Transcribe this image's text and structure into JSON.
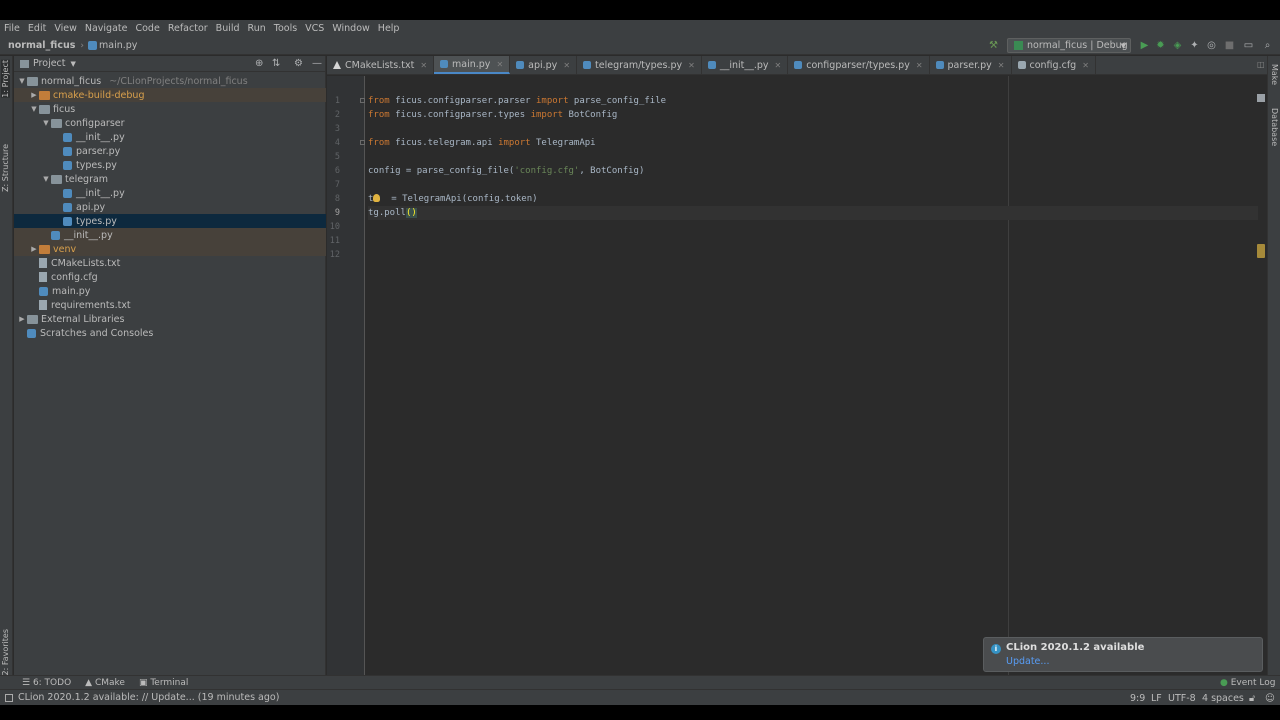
{
  "menu": [
    "File",
    "Edit",
    "View",
    "Navigate",
    "Code",
    "Refactor",
    "Build",
    "Run",
    "Tools",
    "VCS",
    "Window",
    "Help"
  ],
  "breadcrumb": {
    "project": "normal_ficus",
    "file": "main.py"
  },
  "run_config": "normal_ficus | Debug",
  "left_stripe": {
    "project": "1: Project",
    "structure": "Z: Structure",
    "favorites": "2: Favorites"
  },
  "right_stripe": {
    "make": "Make",
    "database": "Database"
  },
  "project_panel": {
    "title": "Project",
    "tree": [
      {
        "label": "normal_ficus",
        "suffix": "~/CLionProjects/normal_ficus",
        "depth": 0,
        "arrow": "▼",
        "icon": "folder"
      },
      {
        "label": "cmake-build-debug",
        "depth": 1,
        "arrow": "▶",
        "icon": "folder-orange",
        "state": "excluded"
      },
      {
        "label": "ficus",
        "depth": 1,
        "arrow": "▼",
        "icon": "folder"
      },
      {
        "label": "configparser",
        "depth": 2,
        "arrow": "▼",
        "icon": "folder"
      },
      {
        "label": "__init__.py",
        "depth": 3,
        "arrow": "",
        "icon": "py"
      },
      {
        "label": "parser.py",
        "depth": 3,
        "arrow": "",
        "icon": "py"
      },
      {
        "label": "types.py",
        "depth": 3,
        "arrow": "",
        "icon": "py"
      },
      {
        "label": "telegram",
        "depth": 2,
        "arrow": "▼",
        "icon": "folder"
      },
      {
        "label": "__init__.py",
        "depth": 3,
        "arrow": "",
        "icon": "py"
      },
      {
        "label": "api.py",
        "depth": 3,
        "arrow": "",
        "icon": "py"
      },
      {
        "label": "types.py",
        "depth": 3,
        "arrow": "",
        "icon": "py",
        "state": "selected"
      },
      {
        "label": "__init__.py",
        "depth": 2,
        "arrow": "",
        "icon": "py",
        "state": "excluded"
      },
      {
        "label": "venv",
        "depth": 1,
        "arrow": "▶",
        "icon": "folder-orange",
        "state": "excluded"
      },
      {
        "label": "CMakeLists.txt",
        "depth": 1,
        "arrow": "",
        "icon": "txt"
      },
      {
        "label": "config.cfg",
        "depth": 1,
        "arrow": "",
        "icon": "txt"
      },
      {
        "label": "main.py",
        "depth": 1,
        "arrow": "",
        "icon": "py"
      },
      {
        "label": "requirements.txt",
        "depth": 1,
        "arrow": "",
        "icon": "txt"
      },
      {
        "label": "External Libraries",
        "depth": 0,
        "arrow": "▶",
        "icon": "lib"
      },
      {
        "label": "Scratches and Consoles",
        "depth": 0,
        "arrow": "",
        "icon": "scratch"
      }
    ]
  },
  "tabs": [
    {
      "label": "CMakeLists.txt",
      "icon": "cm"
    },
    {
      "label": "main.py",
      "icon": "py",
      "active": true
    },
    {
      "label": "api.py",
      "icon": "py"
    },
    {
      "label": "telegram/types.py",
      "icon": "py"
    },
    {
      "label": "__init__.py",
      "icon": "py"
    },
    {
      "label": "configparser/types.py",
      "icon": "py"
    },
    {
      "label": "parser.py",
      "icon": "py"
    },
    {
      "label": "config.cfg",
      "icon": "cfg"
    }
  ],
  "code": [
    [
      [
        "kw",
        "from"
      ],
      [
        "p",
        " ficus.configparser.parser "
      ],
      [
        "kw",
        "import"
      ],
      [
        "p",
        " parse_config_file"
      ]
    ],
    [
      [
        "kw",
        "from"
      ],
      [
        "p",
        " ficus.configparser.types "
      ],
      [
        "kw",
        "import"
      ],
      [
        "p",
        " BotConfig"
      ]
    ],
    [],
    [
      [
        "kw",
        "from"
      ],
      [
        "p",
        " ficus.telegram.api "
      ],
      [
        "kw",
        "import"
      ],
      [
        "p",
        " TelegramApi"
      ]
    ],
    [],
    [
      [
        "p",
        "config = parse_config_file("
      ],
      [
        "str",
        "'config.cfg'"
      ],
      [
        "p",
        ", BotConfig)"
      ]
    ],
    [],
    [
      [
        "p",
        "t"
      ],
      [
        "p",
        "  = TelegramApi(config.token)"
      ]
    ],
    [
      [
        "p",
        "tg.poll"
      ],
      [
        "paren",
        "()"
      ]
    ],
    [],
    [],
    []
  ],
  "caret_line": 9,
  "bottom_tools": [
    "6: TODO",
    "CMake",
    "Terminal"
  ],
  "event_log": "Event Log",
  "status": {
    "message": "CLion 2020.1.2 available: // Update... (19 minutes ago)",
    "position": "9:9",
    "line_sep": "LF",
    "encoding": "UTF-8",
    "indent": "4 spaces"
  },
  "notification": {
    "title": "CLion 2020.1.2 available",
    "link": "Update..."
  },
  "colors": {
    "keyword": "#cc7832",
    "string": "#6a8759",
    "text": "#a9b7c6",
    "selection": "#0d293e"
  }
}
